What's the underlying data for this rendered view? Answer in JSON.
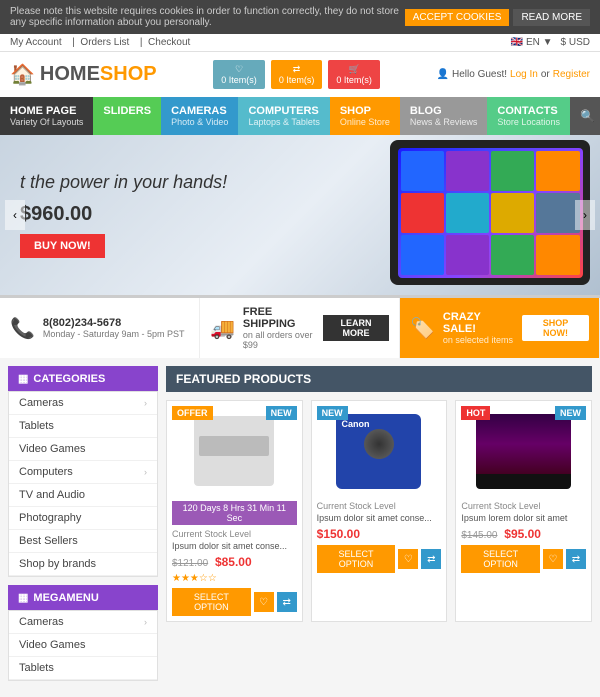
{
  "cookie_banner": {
    "message": "Please note this website requires cookies in order to function correctly, they do not store any specific information about you personally.",
    "accept_label": "ACCEPT COOKIES",
    "read_label": "READ MORE"
  },
  "top_bar": {
    "links": [
      "My Account",
      "Orders List",
      "Checkout"
    ],
    "language": "EN",
    "currency": "$ USD"
  },
  "header": {
    "logo_home": "HOME",
    "logo_shop": "SHOP",
    "icons": [
      {
        "label": "0 Item(s)",
        "type": "wishlist"
      },
      {
        "label": "0 Item(s)",
        "type": "compare"
      },
      {
        "label": "0 Item(s)",
        "type": "cart"
      }
    ],
    "greeting": "Hello Guest!",
    "login": "Log In",
    "register": "Register"
  },
  "nav": {
    "items": [
      {
        "label": "HOME PAGE",
        "sub": "Variety Of Layouts",
        "color": "dark"
      },
      {
        "label": "SLIDERS",
        "sub": "",
        "color": "green"
      },
      {
        "label": "CAMERAS",
        "sub": "Photo & Video",
        "color": "blue"
      },
      {
        "label": "COMPUTERS",
        "sub": "Laptops & Tablets",
        "color": "teal"
      },
      {
        "label": "SHOP",
        "sub": "Online Store",
        "color": "orange"
      },
      {
        "label": "BLOG",
        "sub": "News & Reviews",
        "color": "blog"
      },
      {
        "label": "CONTACTS",
        "sub": "Store Locations",
        "color": "contacts"
      }
    ]
  },
  "hero": {
    "title": "t the power in your hands!",
    "price": "$960.00",
    "button": "BUY NOW!"
  },
  "info_bar": [
    {
      "icon": "📞",
      "title": "8(802)234-5678",
      "sub": "Monday - Saturday 9am - 5pm PST",
      "type": "phone"
    },
    {
      "icon": "🚚",
      "title": "FREE SHIPPING",
      "sub": "on all orders over $99",
      "button": "LEARN MORE",
      "type": "shipping"
    },
    {
      "icon": "🏷️",
      "title": "CRAZY SALE!",
      "sub": "on selected items",
      "button": "SHOP NOW!",
      "type": "sale"
    }
  ],
  "sidebar": {
    "categories_title": "CATEGORIES",
    "categories": [
      {
        "label": "Cameras",
        "arrow": true
      },
      {
        "label": "Tablets",
        "arrow": false
      },
      {
        "label": "Video Games",
        "arrow": false
      },
      {
        "label": "Computers",
        "arrow": true
      },
      {
        "label": "TV and Audio",
        "arrow": false
      },
      {
        "label": "Photography",
        "arrow": false
      },
      {
        "label": "Best Sellers",
        "arrow": false
      },
      {
        "label": "Shop by brands",
        "arrow": false
      }
    ],
    "mega_title": "MEGAMENU",
    "mega_items": [
      {
        "label": "Cameras",
        "arrow": true
      },
      {
        "label": "Video Games",
        "arrow": false
      },
      {
        "label": "Tablets",
        "arrow": false
      }
    ]
  },
  "products": {
    "section_title": "FEATURED PRODUCTS",
    "items": [
      {
        "badge": "OFFER",
        "badge_type": "offer",
        "badge2": "NEW",
        "badge2_type": "new",
        "has_timer": true,
        "timer": "120 Days  8 Hrs  31 Min  11 Sec",
        "stock": "Current Stock Level",
        "desc": "Ipsum dolor sit amet conse...",
        "old_price": "$121.00",
        "new_price": "$85.00",
        "stars": 3,
        "type": "printer"
      },
      {
        "badge": "NEW",
        "badge_type": "new",
        "has_timer": false,
        "stock": "Current Stock Level",
        "desc": "Ipsum dolor sit amet conse...",
        "old_price": null,
        "new_price": "$150.00",
        "stars": 0,
        "type": "camera"
      },
      {
        "badge": "HOT",
        "badge_type": "hot",
        "badge2": "NEW",
        "badge2_type": "new",
        "has_timer": false,
        "stock": "Current Stock Level",
        "desc": "Ipsum lorem dolor sit amet",
        "old_price": "$145.00",
        "new_price": "$95.00",
        "stars": 0,
        "type": "tv"
      }
    ],
    "select_option": "SELECT OPTION"
  }
}
